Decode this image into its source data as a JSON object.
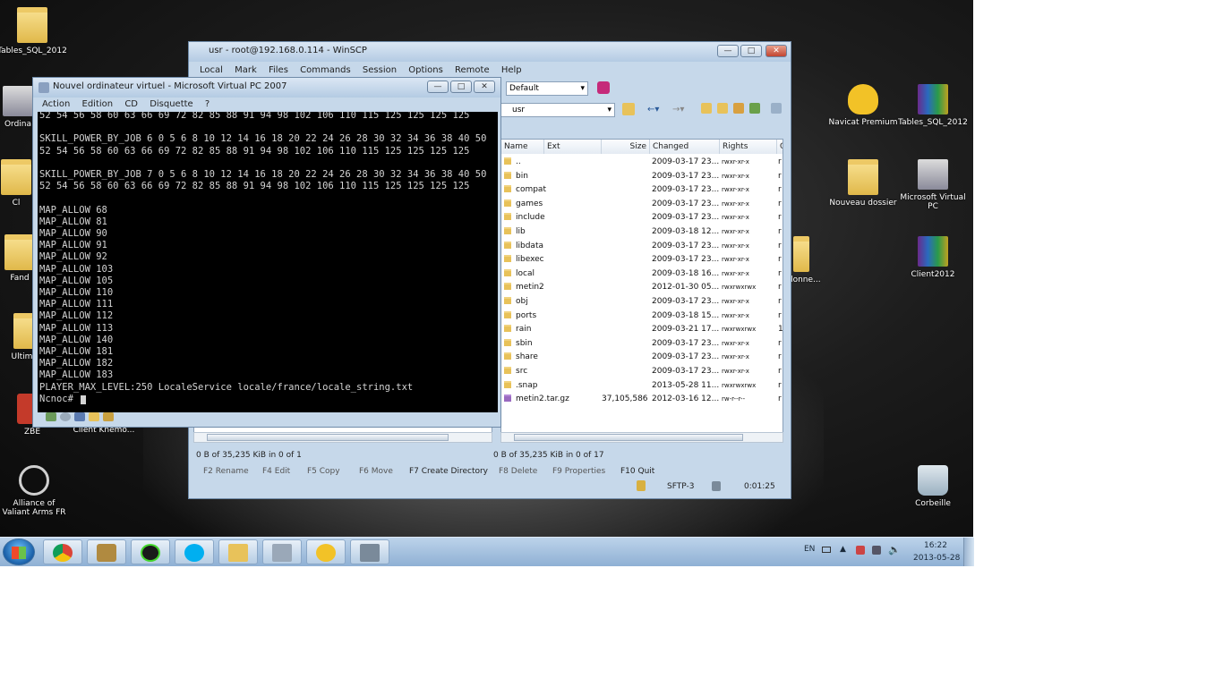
{
  "desktop": {
    "icons_left": [
      {
        "label": "Tables_SQL_2012"
      },
      {
        "label": "Ordina"
      },
      {
        "label": "Cl"
      },
      {
        "label": "Fand"
      },
      {
        "label": "Ultima-C"
      },
      {
        "label": "ZBE"
      },
      {
        "label": "Client Knemo..."
      },
      {
        "label": "Alliance of Valiant Arms FR"
      }
    ],
    "icons_right": [
      {
        "label": "Navicat Premium"
      },
      {
        "label": "Tables_SQL_2012"
      },
      {
        "label": "Nouveau dossier"
      },
      {
        "label": "Microsoft Virtual PC"
      },
      {
        "label": "Client2012"
      },
      {
        "label": "Corbeille"
      }
    ],
    "partial_label": "_donne..."
  },
  "taskbar": {
    "lang": "EN",
    "time": "16:22",
    "date": "2013-05-28"
  },
  "winscp": {
    "title": "usr - root@192.168.0.114 - WinSCP",
    "menu": [
      "Local",
      "Mark",
      "Files",
      "Commands",
      "Session",
      "Options",
      "Remote",
      "Help"
    ],
    "session_select": "Default",
    "path": "usr",
    "columns": [
      "Name",
      "Ext",
      "Size",
      "Changed",
      "Rights",
      "O"
    ],
    "files": [
      {
        "name": "..",
        "size": "",
        "changed": "2009-03-17 23...",
        "rights": "rwxr-xr-x",
        "o": "r"
      },
      {
        "name": "bin",
        "size": "",
        "changed": "2009-03-17 23...",
        "rights": "rwxr-xr-x",
        "o": "r"
      },
      {
        "name": "compat",
        "size": "",
        "changed": "2009-03-17 23...",
        "rights": "rwxr-xr-x",
        "o": "r"
      },
      {
        "name": "games",
        "size": "",
        "changed": "2009-03-17 23...",
        "rights": "rwxr-xr-x",
        "o": "r"
      },
      {
        "name": "include",
        "size": "",
        "changed": "2009-03-17 23...",
        "rights": "rwxr-xr-x",
        "o": "r"
      },
      {
        "name": "lib",
        "size": "",
        "changed": "2009-03-18 12...",
        "rights": "rwxr-xr-x",
        "o": "r"
      },
      {
        "name": "libdata",
        "size": "",
        "changed": "2009-03-17 23...",
        "rights": "rwxr-xr-x",
        "o": "r"
      },
      {
        "name": "libexec",
        "size": "",
        "changed": "2009-03-17 23...",
        "rights": "rwxr-xr-x",
        "o": "r"
      },
      {
        "name": "local",
        "size": "",
        "changed": "2009-03-18 16...",
        "rights": "rwxr-xr-x",
        "o": "r"
      },
      {
        "name": "metin2",
        "size": "",
        "changed": "2012-01-30 05...",
        "rights": "rwxrwxrwx",
        "o": "r"
      },
      {
        "name": "obj",
        "size": "",
        "changed": "2009-03-17 23...",
        "rights": "rwxr-xr-x",
        "o": "r"
      },
      {
        "name": "ports",
        "size": "",
        "changed": "2009-03-18 15...",
        "rights": "rwxr-xr-x",
        "o": "r"
      },
      {
        "name": "rain",
        "size": "",
        "changed": "2009-03-21 17...",
        "rights": "rwxrwxrwx",
        "o": "1"
      },
      {
        "name": "sbin",
        "size": "",
        "changed": "2009-03-17 23...",
        "rights": "rwxr-xr-x",
        "o": "r"
      },
      {
        "name": "share",
        "size": "",
        "changed": "2009-03-17 23...",
        "rights": "rwxr-xr-x",
        "o": "r"
      },
      {
        "name": "src",
        "size": "",
        "changed": "2009-03-17 23...",
        "rights": "rwxr-xr-x",
        "o": "r"
      },
      {
        "name": ".snap",
        "size": "",
        "changed": "2013-05-28 11...",
        "rights": "rwxrwxrwx",
        "o": "r"
      },
      {
        "name": "metin2.tar.gz",
        "size": "37,105,586",
        "changed": "2012-03-16 12...",
        "rights": "rw-r--r--",
        "o": "r"
      }
    ],
    "status_left": "0 B of 35,235 KiB in 0 of 1",
    "status_right": "0 B of 35,235 KiB in 0 of 17",
    "fkeys": [
      "F2 Rename",
      "F4 Edit",
      "F5 Copy",
      "F6 Move",
      "F7 Create Directory",
      "F8 Delete",
      "F9 Properties",
      "F10 Quit"
    ],
    "protocol": "SFTP-3",
    "elapsed": "0:01:25"
  },
  "vpc": {
    "title": "Nouvel ordinateur virtuel - Microsoft Virtual PC 2007",
    "menu": [
      "Action",
      "Edition",
      "CD",
      "Disquette",
      "?"
    ],
    "console": [
      "52 54 56 58 60 63 66 69 72 82 85 88 91 94 98 102 106 110 115 125 125 125 125",
      "",
      "SKILL_POWER_BY_JOB 6 0 5 6 8 10 12 14 16 18 20 22 24 26 28 30 32 34 36 38 40 50",
      "52 54 56 58 60 63 66 69 72 82 85 88 91 94 98 102 106 110 115 125 125 125 125",
      "",
      "SKILL_POWER_BY_JOB 7 0 5 6 8 10 12 14 16 18 20 22 24 26 28 30 32 34 36 38 40 50",
      "52 54 56 58 60 63 66 69 72 82 85 88 91 94 98 102 106 110 115 125 125 125 125",
      "",
      "MAP_ALLOW 68",
      "MAP_ALLOW 81",
      "MAP_ALLOW 90",
      "MAP_ALLOW 91",
      "MAP_ALLOW 92",
      "MAP_ALLOW 103",
      "MAP_ALLOW 105",
      "MAP_ALLOW 110",
      "MAP_ALLOW 111",
      "MAP_ALLOW 112",
      "MAP_ALLOW 113",
      "MAP_ALLOW 140",
      "MAP_ALLOW 181",
      "MAP_ALLOW 182",
      "MAP_ALLOW 183",
      "PLAYER_MAX_LEVEL:250 LocaleService locale/france/locale_string.txt",
      "Ncnoc#"
    ]
  },
  "colors": {
    "desktop": "#111111",
    "taskbar": "#a9c4e0",
    "console_bg": "#000000",
    "console_fg": "#d4d4d4"
  }
}
